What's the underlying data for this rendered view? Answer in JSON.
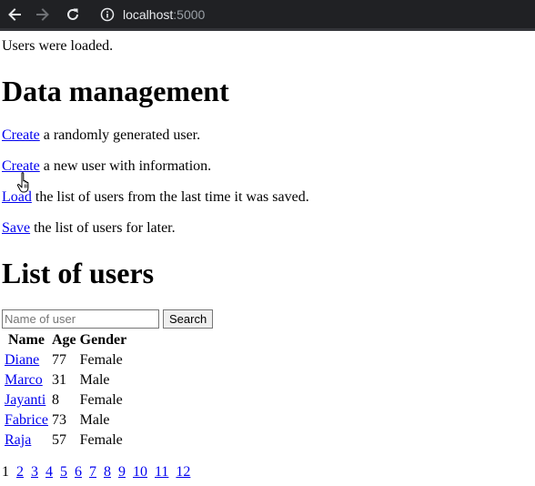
{
  "browser": {
    "url_host": "localhost",
    "url_port": ":5000"
  },
  "status_message": "Users were loaded.",
  "data_management": {
    "heading": "Data management",
    "items": [
      {
        "link": "Create",
        "text": " a randomly generated user."
      },
      {
        "link": "Create",
        "text": " a new user with information."
      },
      {
        "link": "Load",
        "text": " the list of users from the last time it was saved."
      },
      {
        "link": "Save",
        "text": " the list of users for later."
      }
    ]
  },
  "user_list": {
    "heading": "List of users",
    "search": {
      "placeholder": "Name of user",
      "value": "",
      "button_label": "Search"
    },
    "columns": [
      "Name",
      "Age",
      "Gender"
    ],
    "rows": [
      {
        "name": "Diane",
        "age": "77",
        "gender": "Female"
      },
      {
        "name": "Marco",
        "age": "31",
        "gender": "Male"
      },
      {
        "name": "Jayanti",
        "age": "8",
        "gender": "Female"
      },
      {
        "name": "Fabrice",
        "age": "73",
        "gender": "Male"
      },
      {
        "name": "Raja",
        "age": "57",
        "gender": "Female"
      }
    ],
    "pagination": {
      "current": "1",
      "pages": [
        "2",
        "3",
        "4",
        "5",
        "6",
        "7",
        "8",
        "9",
        "10",
        "11",
        "12"
      ]
    }
  },
  "icons": {
    "back": "arrow-left-icon",
    "forward": "arrow-right-icon",
    "reload": "reload-icon",
    "info": "info-icon",
    "cursor": "hand-pointer-icon"
  },
  "colors": {
    "chrome_bg": "#202124",
    "link": "#0000ee",
    "forward_disabled": "#6f7175"
  }
}
